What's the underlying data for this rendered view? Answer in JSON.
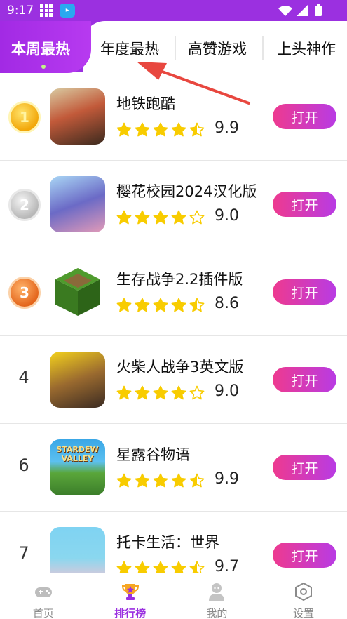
{
  "status_bar": {
    "time": "9:17"
  },
  "tabs": [
    {
      "label": "本周最热",
      "active": true
    },
    {
      "label": "年度最热",
      "active": false
    },
    {
      "label": "高赞游戏",
      "active": false
    },
    {
      "label": "上头神作",
      "active": false
    }
  ],
  "list": [
    {
      "rank": "1",
      "medal": "gold",
      "name": "地铁跑酷",
      "rating": 4.5,
      "score": "9.9",
      "button": "打开",
      "icon": "subway-surfers-icon"
    },
    {
      "rank": "2",
      "medal": "silver",
      "name": "樱花校园2024汉化版",
      "rating": 4.0,
      "score": "9.0",
      "button": "打开",
      "icon": "sakura-school-icon"
    },
    {
      "rank": "3",
      "medal": "bronze",
      "name": "生存战争2.2插件版",
      "rating": 4.5,
      "score": "8.6",
      "button": "打开",
      "icon": "survivalcraft-icon"
    },
    {
      "rank": "4",
      "medal": "",
      "name": "火柴人战争3英文版",
      "rating": 4.0,
      "score": "9.0",
      "button": "打开",
      "icon": "stick-war-icon"
    },
    {
      "rank": "6",
      "medal": "",
      "name": "星露谷物语",
      "rating": 4.5,
      "score": "9.9",
      "button": "打开",
      "icon": "stardew-valley-icon"
    },
    {
      "rank": "7",
      "medal": "",
      "name": "托卡生活：世界",
      "rating": 4.5,
      "score": "9.7",
      "button": "打开",
      "icon": "toca-life-icon"
    }
  ],
  "icon_texts": {
    "stardew": "STARDEW VALLEY"
  },
  "bottom_nav": [
    {
      "label": "首页",
      "icon": "gamepad-icon",
      "active": false
    },
    {
      "label": "排行榜",
      "icon": "trophy-icon",
      "active": true
    },
    {
      "label": "我的",
      "icon": "user-icon",
      "active": false
    },
    {
      "label": "设置",
      "icon": "settings-hex-icon",
      "active": false
    }
  ],
  "colors": {
    "brand_purple": "#9b30e0",
    "button_gradient_start": "#ee3a8f",
    "button_gradient_end": "#b83be4",
    "star": "#f8cc00",
    "arrow": "#e8473f"
  }
}
